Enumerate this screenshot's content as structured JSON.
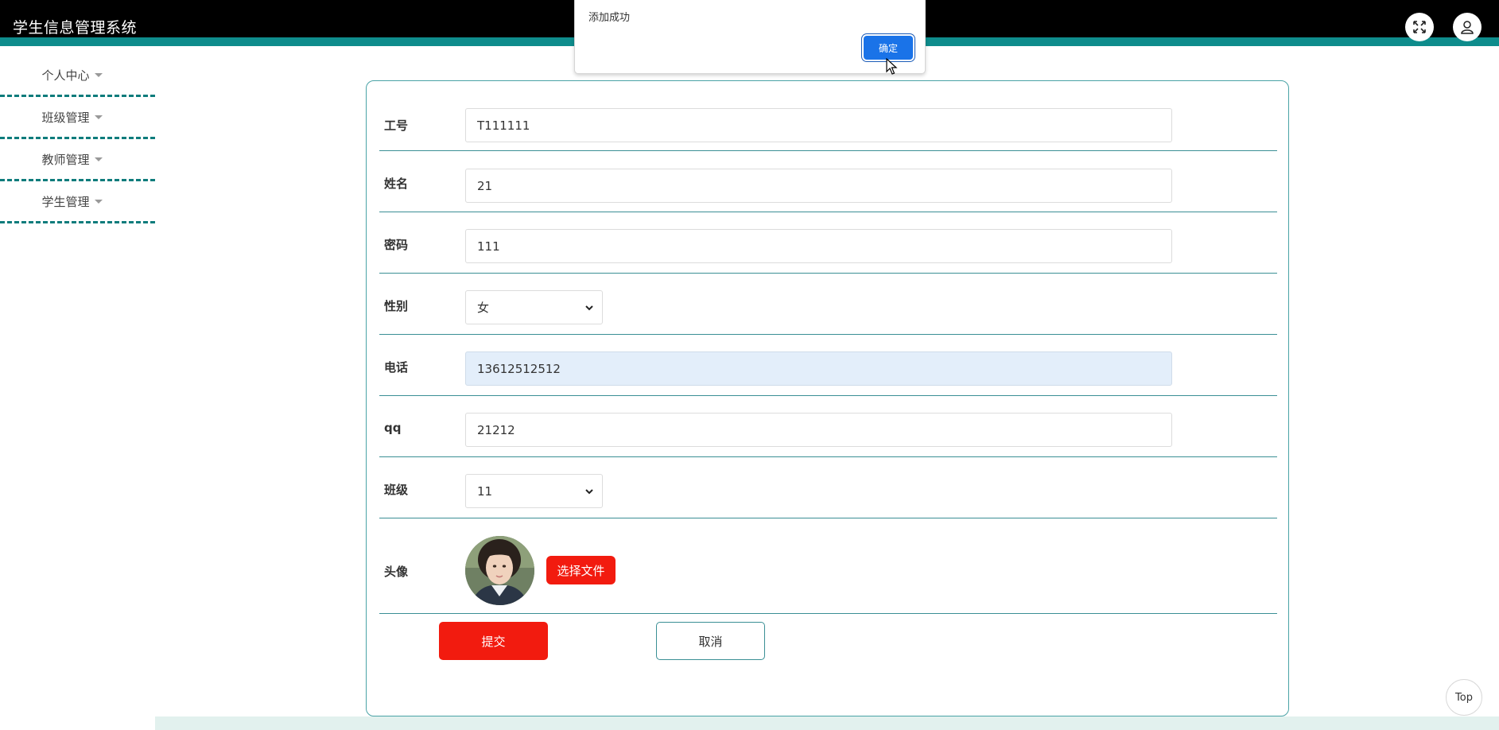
{
  "header": {
    "app_title": "学生信息管理系统",
    "expand_icon": "fullscreen-icon",
    "user_icon": "user-icon"
  },
  "sidebar": {
    "items": [
      {
        "label": "个人中心"
      },
      {
        "label": "班级管理"
      },
      {
        "label": "教师管理"
      },
      {
        "label": "学生管理"
      }
    ]
  },
  "form": {
    "fields": {
      "job_no": {
        "label": "工号",
        "value": "T111111"
      },
      "name": {
        "label": "姓名",
        "value": "21"
      },
      "password": {
        "label": "密码",
        "value": "111"
      },
      "gender": {
        "label": "性别",
        "value": "女"
      },
      "phone": {
        "label": "电话",
        "value": "13612512512"
      },
      "qq": {
        "label": "qq",
        "value": "21212"
      },
      "class": {
        "label": "班级",
        "value": "11"
      },
      "avatar": {
        "label": "头像",
        "file_button": "选择文件"
      }
    },
    "submit_label": "提交",
    "cancel_label": "取消"
  },
  "dialog": {
    "message": "添加成功",
    "ok_label": "确定"
  },
  "back_to_top_label": "Top",
  "colors": {
    "header_bg": "#000000",
    "accent_teal": "#0e8c8c",
    "primary_red": "#f21b0f",
    "dialog_blue": "#1a73e8"
  }
}
